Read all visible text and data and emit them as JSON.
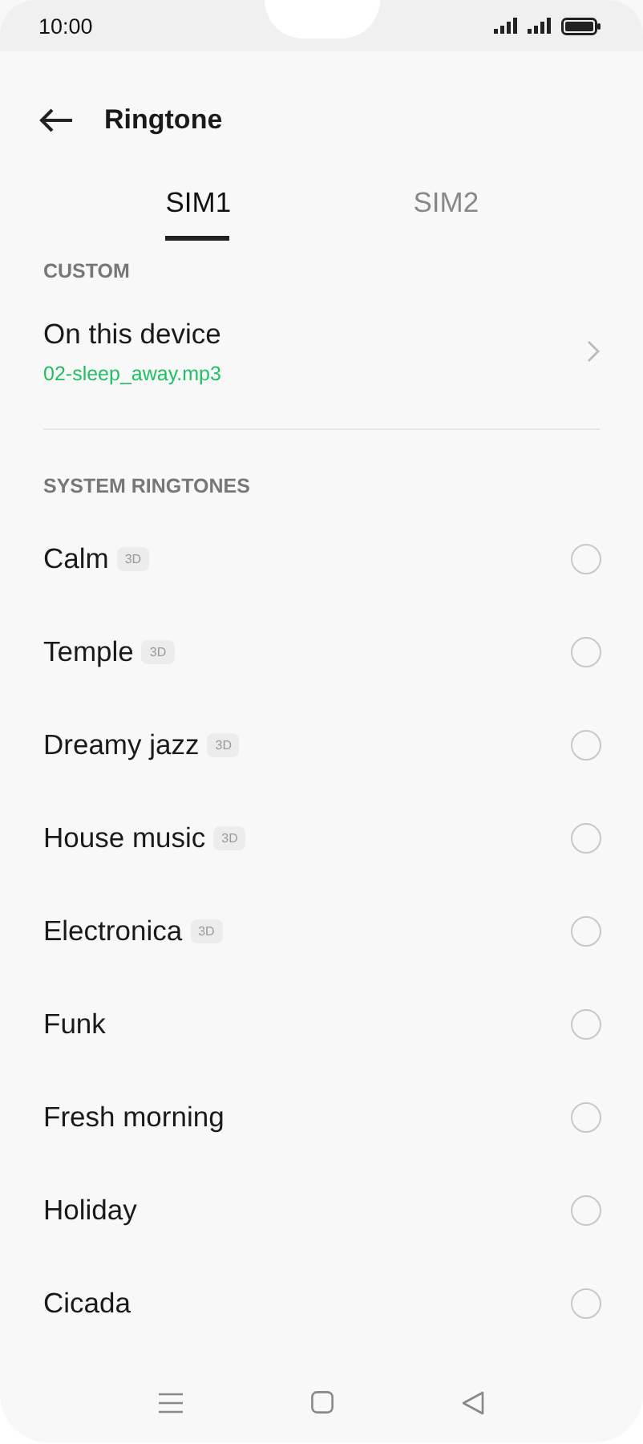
{
  "status_bar": {
    "time": "10:00"
  },
  "header": {
    "title": "Ringtone"
  },
  "tabs": [
    {
      "label": "SIM1",
      "selected": true
    },
    {
      "label": "SIM2",
      "selected": false
    }
  ],
  "custom": {
    "heading": "CUSTOM",
    "title": "On this device",
    "file": "02-sleep_away.mp3"
  },
  "system": {
    "heading": "SYSTEM RINGTONES",
    "items": [
      {
        "name": "Calm",
        "badge": "3D",
        "selected": false
      },
      {
        "name": "Temple",
        "badge": "3D",
        "selected": false
      },
      {
        "name": "Dreamy jazz",
        "badge": "3D",
        "selected": false
      },
      {
        "name": "House music",
        "badge": "3D",
        "selected": false
      },
      {
        "name": "Electronica",
        "badge": "3D",
        "selected": false
      },
      {
        "name": "Funk",
        "selected": false
      },
      {
        "name": "Fresh morning",
        "selected": false
      },
      {
        "name": "Holiday",
        "selected": false
      },
      {
        "name": "Cicada",
        "selected": false
      }
    ]
  }
}
